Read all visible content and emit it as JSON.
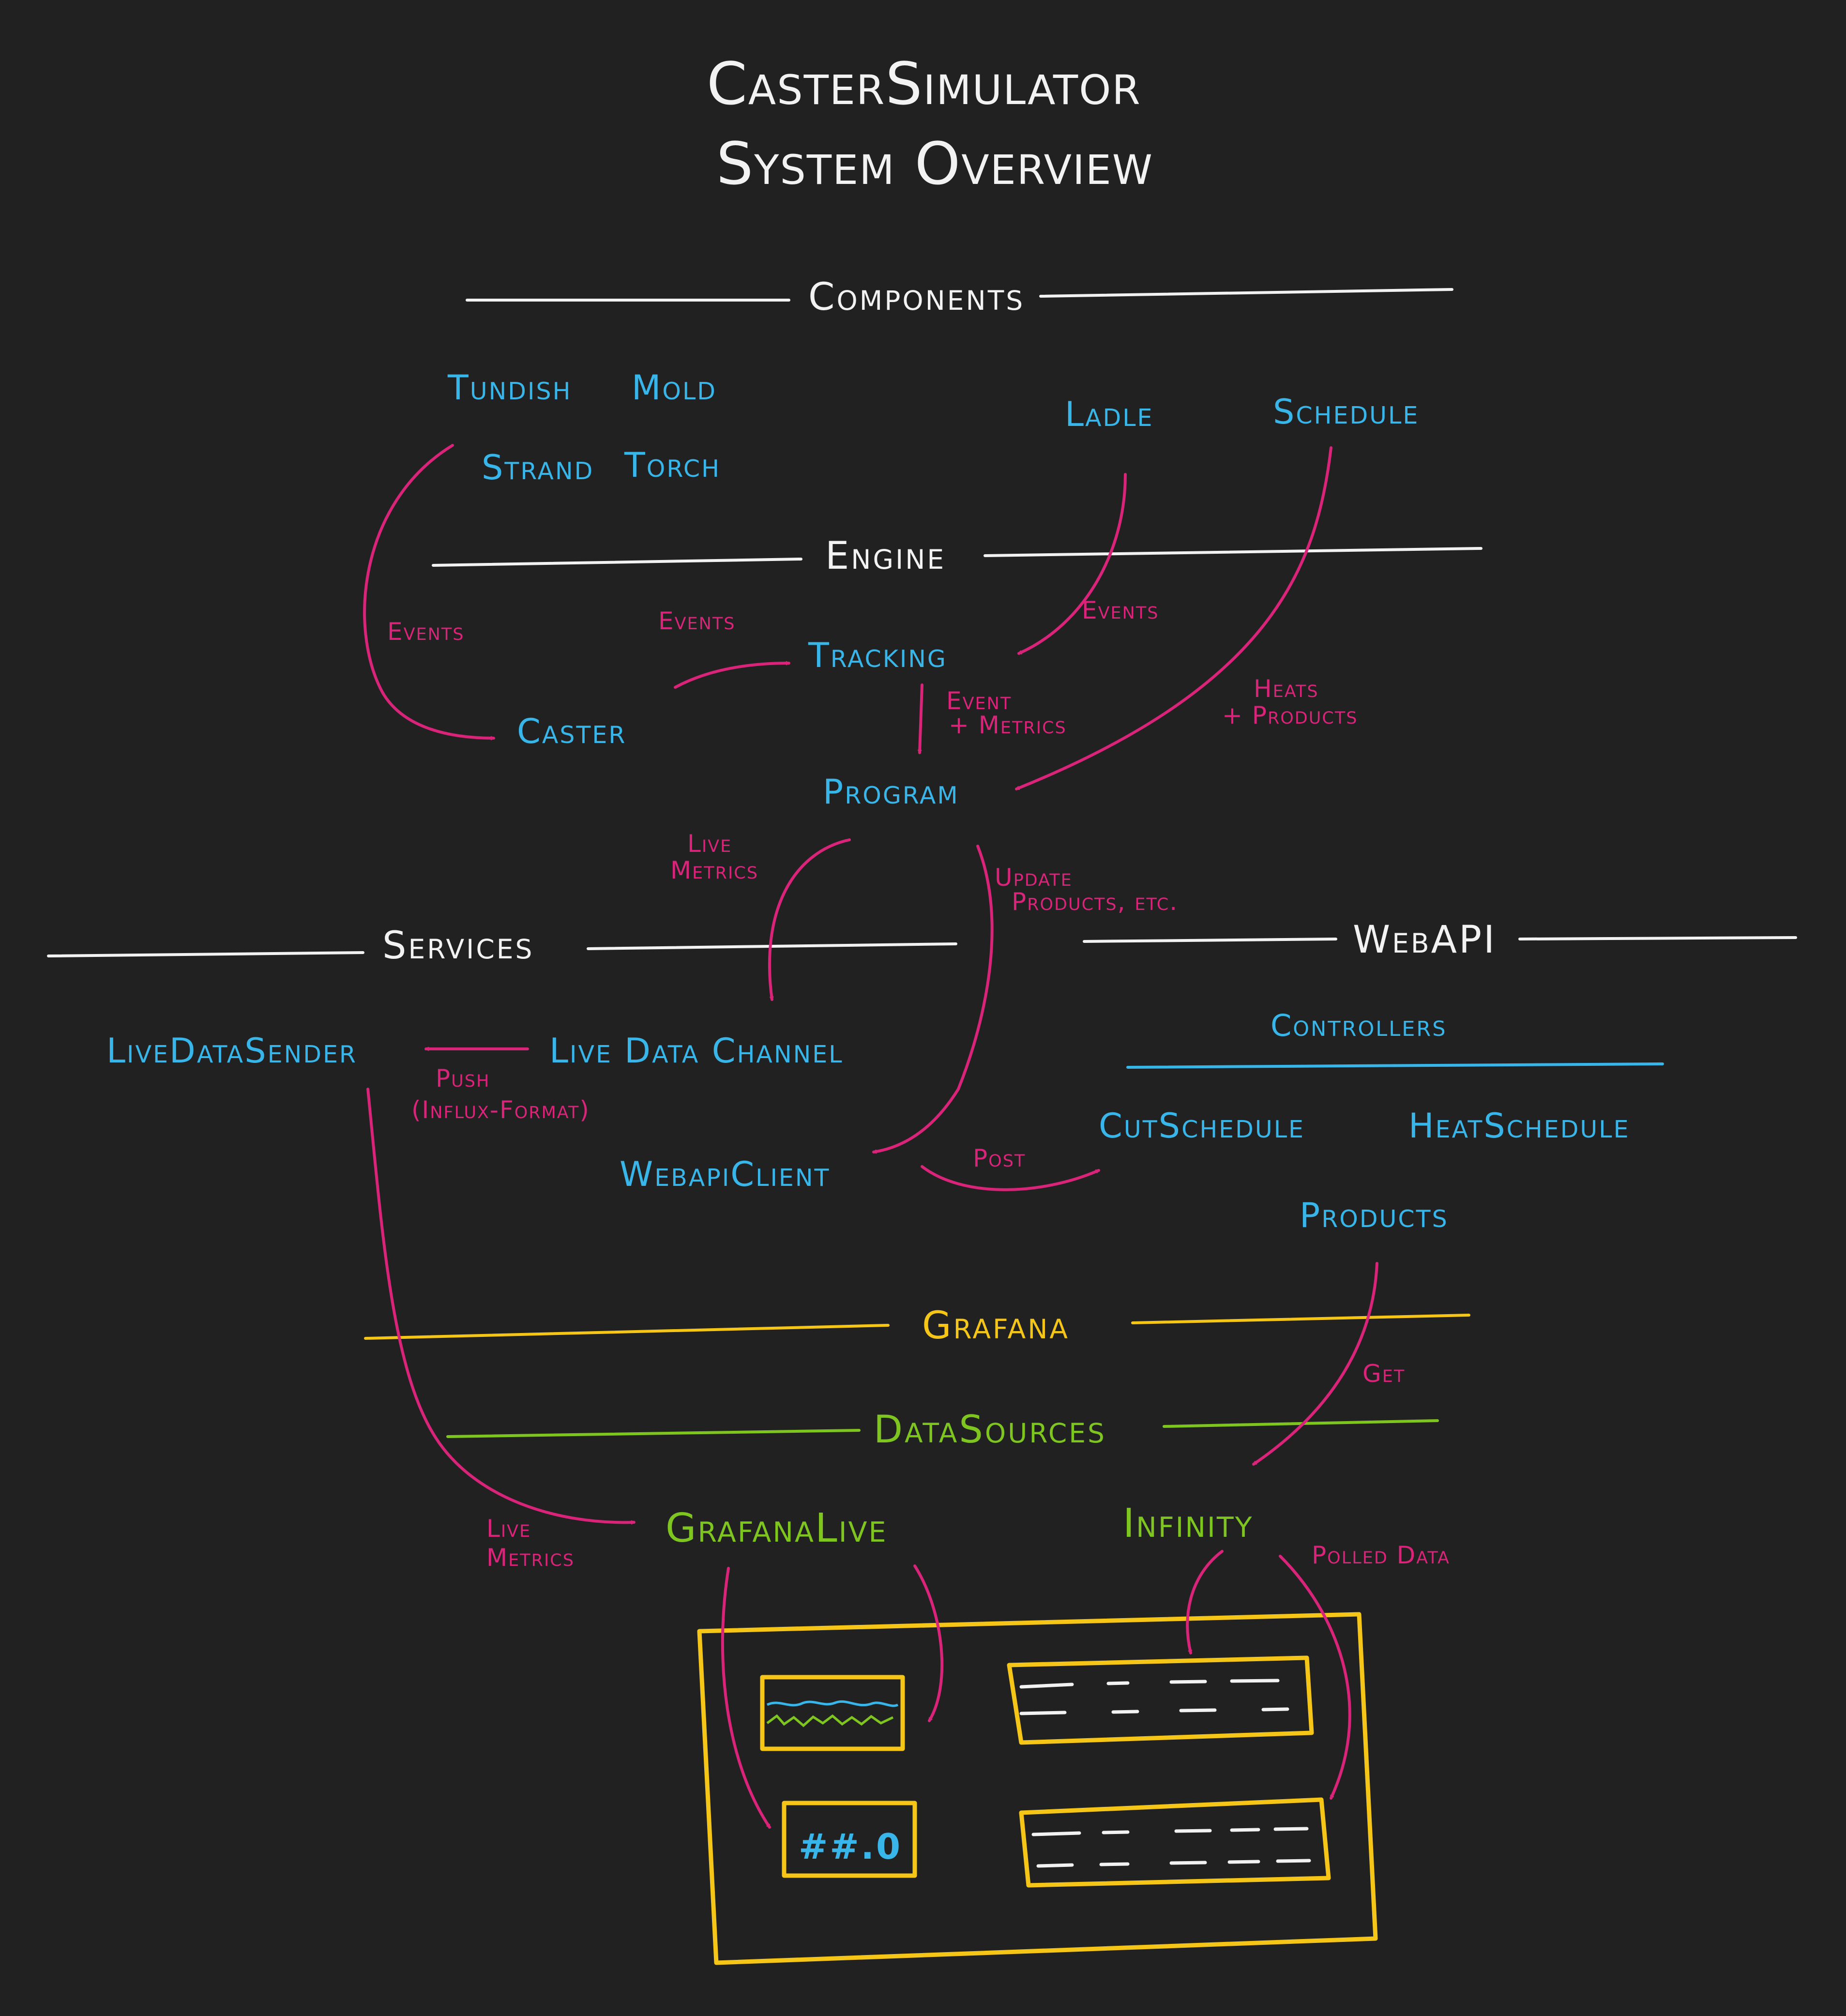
{
  "title": {
    "line1": "CasterSimulator",
    "line2": "System Overview"
  },
  "sections": {
    "components": "Components",
    "engine": "Engine",
    "services": "Services",
    "webapi": "WebAPI",
    "grafana": "Grafana",
    "datasources": "DataSources"
  },
  "components": {
    "tundish": "Tundish",
    "mold": "Mold",
    "strand": "Strand",
    "torch": "Torch",
    "ladle": "Ladle",
    "schedule": "Schedule"
  },
  "engine": {
    "tracking": "Tracking",
    "caster": "Caster",
    "program": "Program"
  },
  "services": {
    "live_data_sender": "LiveDataSender",
    "live_data_channel": "Live Data Channel",
    "webapi_client": "WebapiClient"
  },
  "webapi": {
    "controllers": "Controllers",
    "cut_schedule": "CutSchedule",
    "heat_schedule": "HeatSchedule",
    "products": "Products"
  },
  "datasources": {
    "grafana_live": "GrafanaLive",
    "infinity": "Infinity"
  },
  "arrow_labels": {
    "events_left": "Events",
    "events_mid": "Events",
    "events_right": "Events",
    "event_metrics_1": "Event",
    "event_metrics_2": "+ Metrics",
    "heats_products_1": "Heats",
    "heats_products_2": "+ Products",
    "live_metrics_top_1": "Live",
    "live_metrics_top_2": "Metrics",
    "update_products_1": "Update",
    "update_products_2": "Products, etc.",
    "push_1": "Push",
    "push_2": "(Influx-Format)",
    "post": "Post",
    "get": "Get",
    "live_metrics_bottom_1": "Live",
    "live_metrics_bottom_2": "Metrics",
    "polled_data": "Polled Data"
  },
  "dashboard": {
    "stat_value": "##.0"
  },
  "colors": {
    "background": "#212121",
    "text_white": "#f2f2f2",
    "component_blue": "#38b6ea",
    "arrow_magenta": "#d9247a",
    "grafana_yellow": "#f5c518",
    "datasource_green": "#7ec51f"
  }
}
